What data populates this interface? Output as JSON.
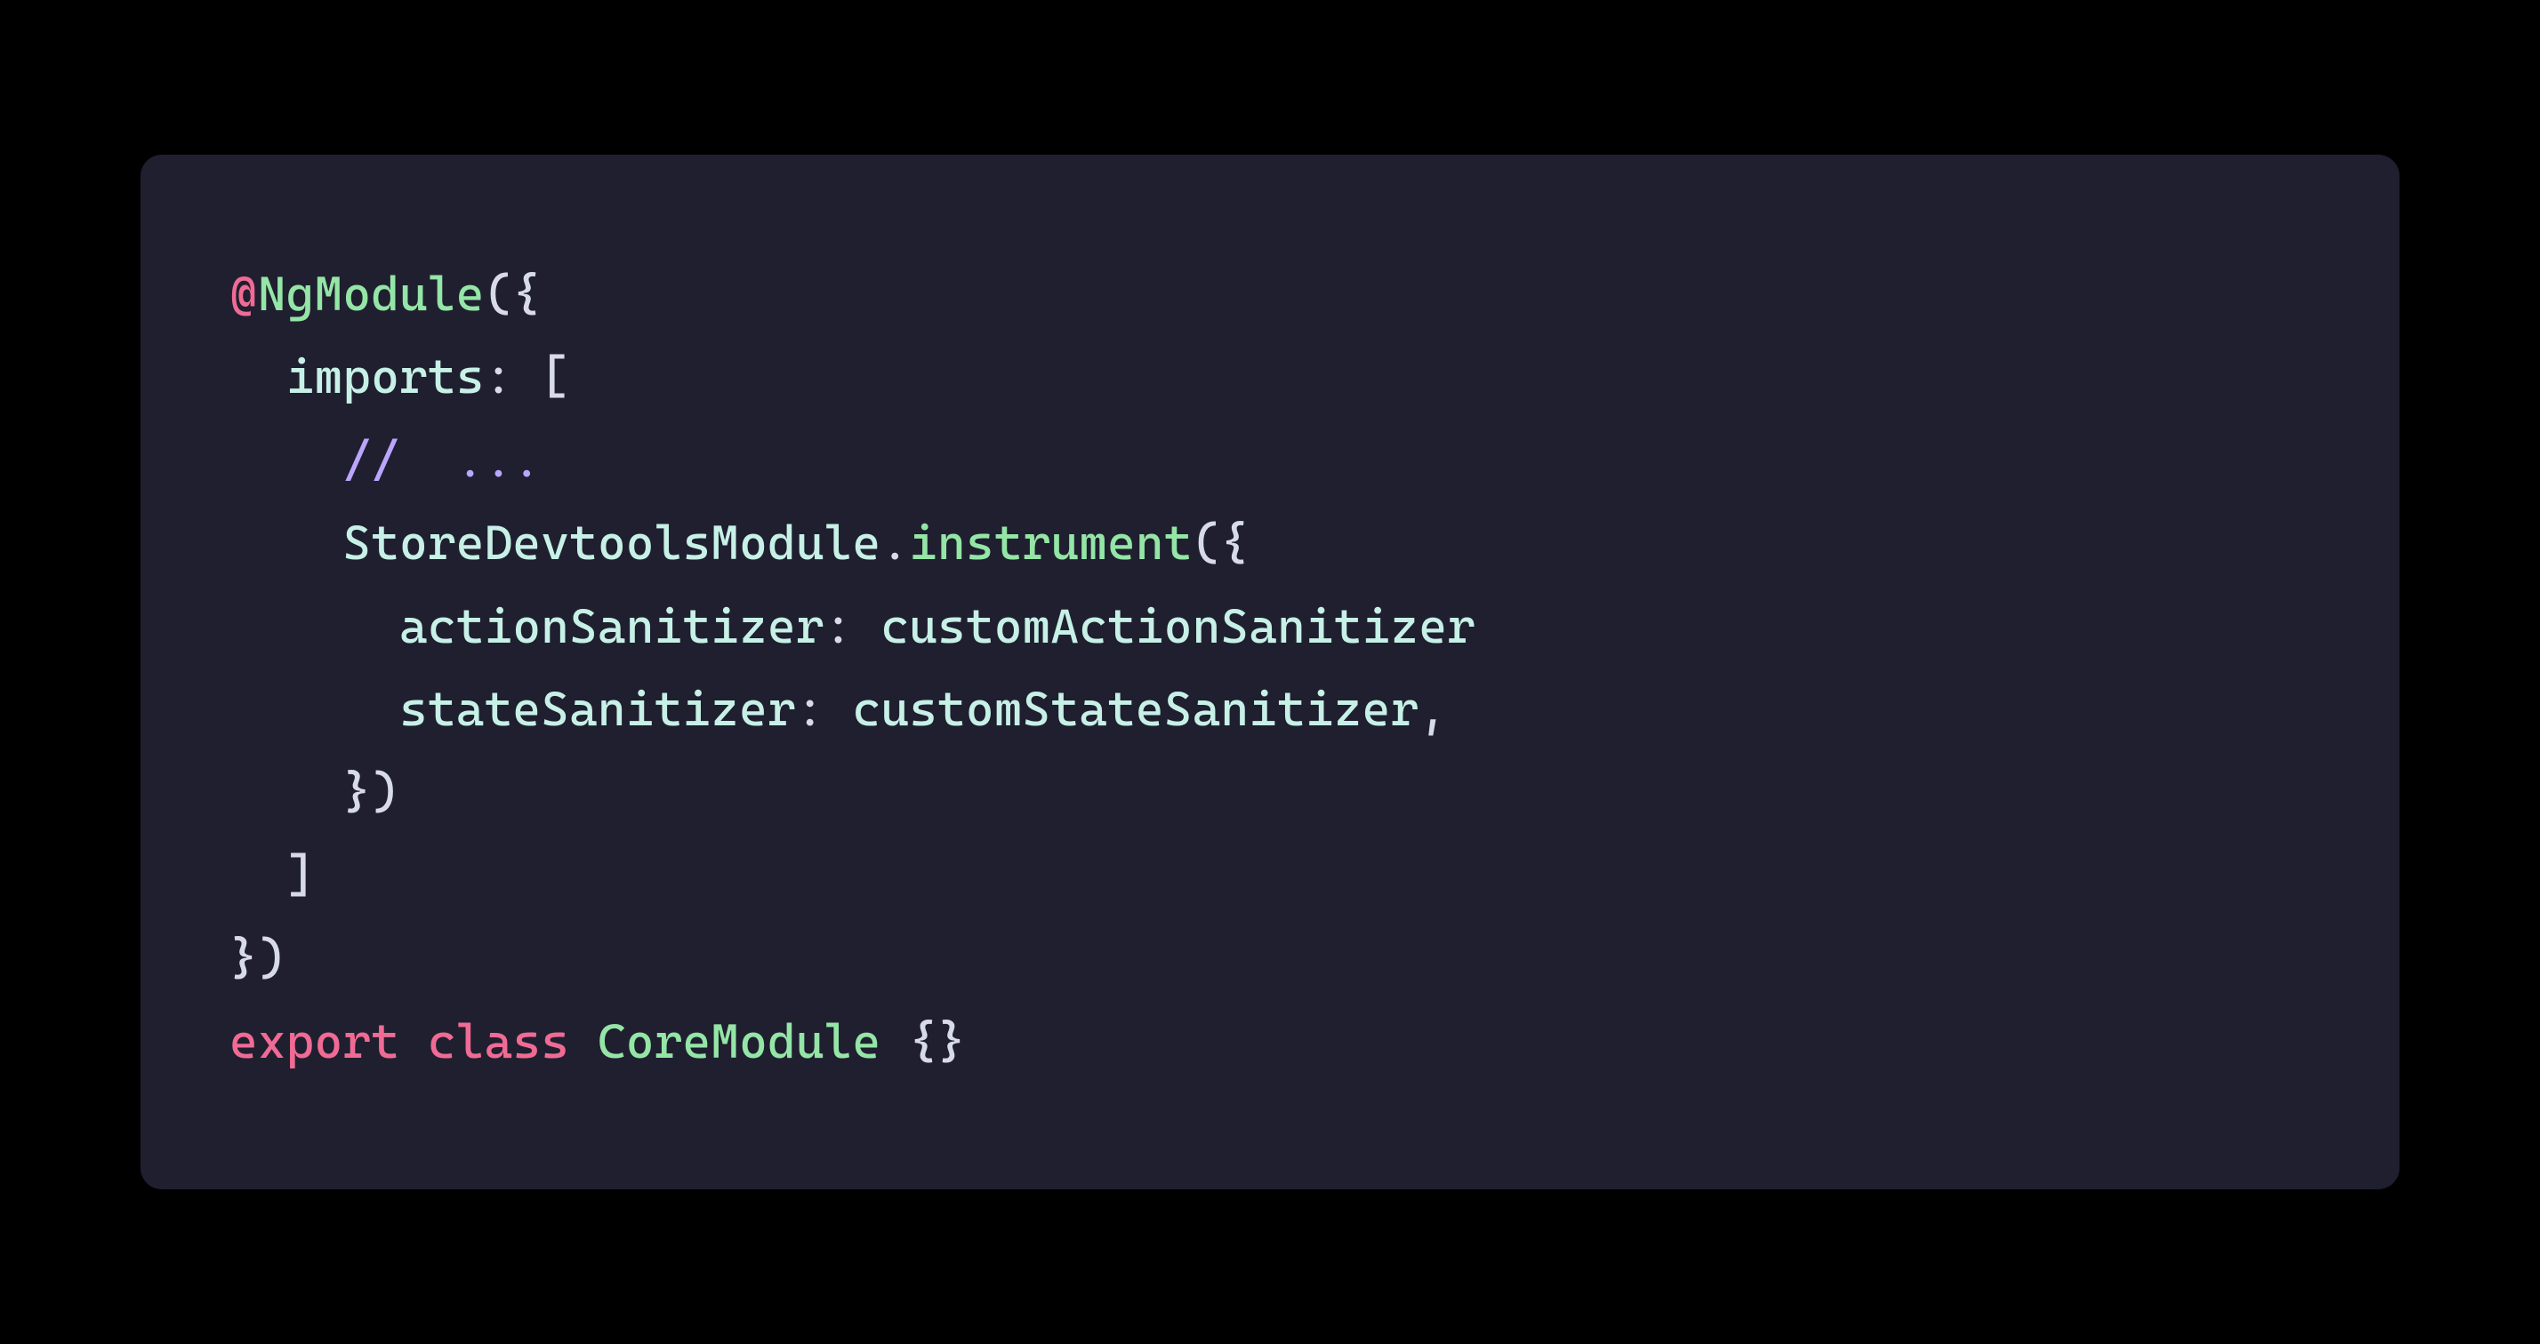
{
  "code": {
    "l1": {
      "at": "@",
      "decorator": "NgModule",
      "open": "({"
    },
    "l2": {
      "indent": "  ",
      "prop": "imports",
      "colon": ": [",
      "bracket": ""
    },
    "l3": {
      "indent": "    ",
      "comment": "//  ..."
    },
    "l4": {
      "indent": "    ",
      "class": "StoreDevtoolsModule",
      "dot": ".",
      "method": "instrument",
      "open": "({"
    },
    "l5": {
      "indent": "      ",
      "prop": "actionSanitizer",
      "colon": ": ",
      "value": "customActionSanitizer"
    },
    "l6": {
      "indent": "      ",
      "prop": "stateSanitizer",
      "colon": ": ",
      "value": "customStateSanitizer",
      "comma": ","
    },
    "l7": {
      "indent": "    ",
      "close": "})"
    },
    "l8": {
      "indent": "  ",
      "close": "]"
    },
    "l9": {
      "close": "})"
    },
    "l10": {
      "kw1": "export",
      "sp1": " ",
      "kw2": "class",
      "sp2": " ",
      "name": "CoreModule",
      "sp3": " ",
      "braces": "{}"
    }
  },
  "colors": {
    "background": "#000000",
    "panel": "#1f1f30",
    "default": "#d7dbe8",
    "pink": "#f06b94",
    "green": "#94e5a6",
    "cyan": "#c7f0e6",
    "purple": "#bba6ff"
  }
}
